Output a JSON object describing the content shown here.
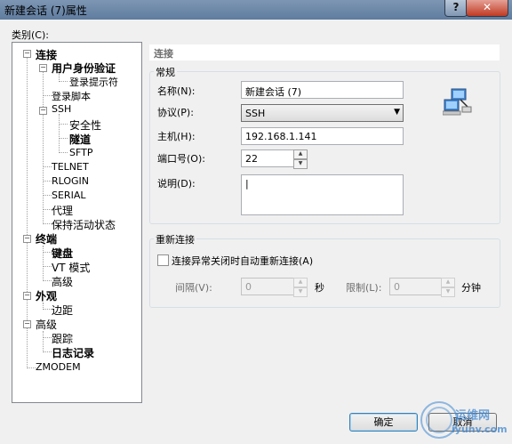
{
  "window": {
    "title": "新建会话 (7)属性",
    "help": "?",
    "close": "✕"
  },
  "category_label": "类别(C):",
  "tree": {
    "connection": "连接",
    "user_auth": "用户身份验证",
    "login_prompt": "登录提示符",
    "login_script": "登录脚本",
    "ssh": "SSH",
    "security": "安全性",
    "tunnel": "隧道",
    "sftp": "SFTP",
    "telnet": "TELNET",
    "rlogin": "RLOGIN",
    "serial": "SERIAL",
    "proxy": "代理",
    "keepalive": "保持活动状态",
    "terminal": "终端",
    "keyboard": "键盘",
    "vt_mode": "VT 模式",
    "advanced1": "高级",
    "appearance": "外观",
    "margin": "边距",
    "advanced": "高级",
    "trace": "跟踪",
    "logging": "日志记录",
    "zmodem": "ZMODEM"
  },
  "section_header": "连接",
  "general": {
    "title": "常规",
    "name_label": "名称(N):",
    "name_value": "新建会话 (7)",
    "protocol_label": "协议(P):",
    "protocol_value": "SSH",
    "host_label": "主机(H):",
    "host_value": "192.168.1.141",
    "port_label": "端口号(O):",
    "port_value": "22",
    "desc_label": "说明(D):",
    "desc_value": "|"
  },
  "reconnect": {
    "title": "重新连接",
    "checkbox_label": "连接异常关闭时自动重新连接(A)",
    "interval_label": "间隔(V):",
    "interval_value": "0",
    "seconds": "秒",
    "limit_label": "限制(L):",
    "limit_value": "0",
    "minutes": "分钟"
  },
  "buttons": {
    "ok": "确定",
    "cancel": "取消"
  },
  "watermark": {
    "line1": "运维网",
    "line2": "iyunv.com"
  }
}
